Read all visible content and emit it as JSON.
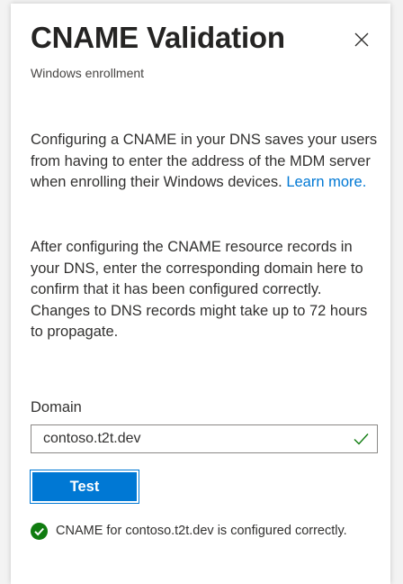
{
  "panel": {
    "title": "CNAME Validation",
    "subtitle": "Windows enrollment",
    "close_icon": "close-icon"
  },
  "content": {
    "paragraph1": "Configuring a CNAME in your DNS saves your users from having to enter the address of the MDM server when enrolling their Windows devices.",
    "learn_more": "Learn more.",
    "paragraph2": "After configuring the CNAME resource records in your DNS, enter the corresponding domain here to confirm that it has been configured correctly. Changes to DNS records might take up to 72 hours to propagate."
  },
  "domain_field": {
    "label": "Domain",
    "value": "contoso.t2t.dev",
    "valid_icon": "checkmark-icon"
  },
  "test_button": {
    "label": "Test"
  },
  "status": {
    "icon": "success-check-icon",
    "message": "CNAME for contoso.t2t.dev is configured correctly."
  },
  "colors": {
    "accent": "#0078d4",
    "success": "#107c10",
    "text": "#323130"
  }
}
